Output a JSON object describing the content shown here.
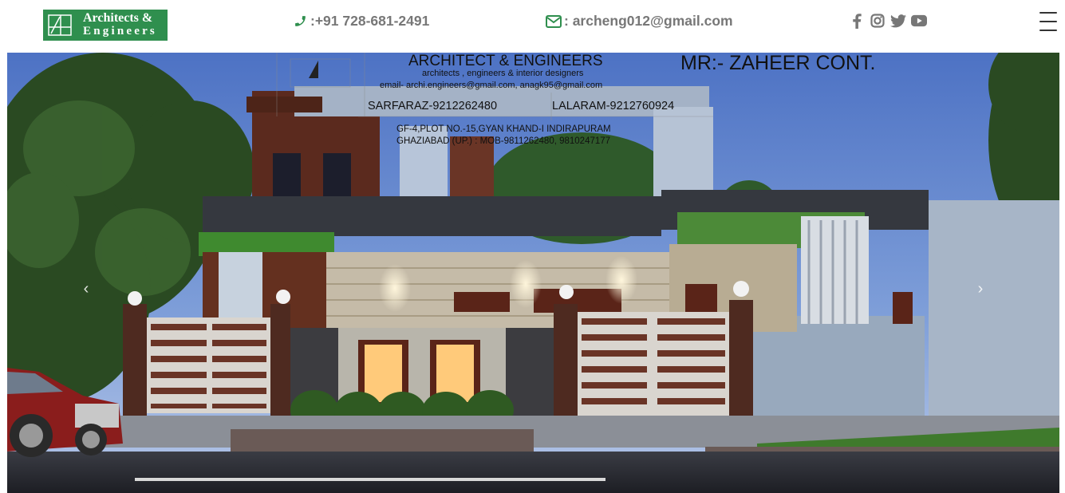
{
  "brand": {
    "logo_line1": "Architects &",
    "logo_line2": "Engineers",
    "color": "#2f8f4e"
  },
  "header": {
    "phone": ":+91 728-681-2491",
    "email": ": archeng012@gmail.com",
    "phone_icon": "phone-icon",
    "email_icon": "envelope-icon",
    "social": [
      "facebook-icon",
      "instagram-icon",
      "twitter-icon",
      "youtube-icon"
    ],
    "menu_icon": "hamburger-menu-icon"
  },
  "slider": {
    "prev_label": "‹",
    "next_label": "›",
    "overlay": {
      "title": "ARCHITECT & ENGINEERS",
      "client": "MR:- ZAHEER CONT.",
      "subtitle": "architects , engineers & interior designers",
      "email_line": "email- archi.engineers@gmail.com, anagk95@gmail.com",
      "person1": "SARFARAZ-9212262480",
      "person2": "LALARAM-9212760924",
      "address1": "GF-4,PLOT NO.-15,GYAN KHAND-I INDIRAPURAM",
      "address2": "GHAZIABAD (UP.) : MOB-9811262480, 9810247177"
    }
  }
}
